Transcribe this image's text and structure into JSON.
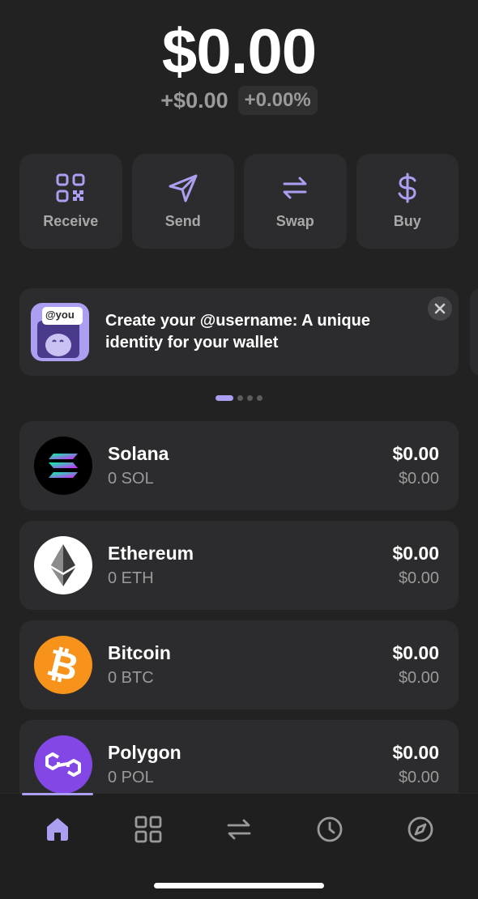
{
  "balance": {
    "total": "$0.00",
    "change_usd": "+$0.00",
    "change_pct": "+0.00%"
  },
  "actions": [
    {
      "label": "Receive",
      "icon": "qr-code-icon"
    },
    {
      "label": "Send",
      "icon": "send-icon"
    },
    {
      "label": "Swap",
      "icon": "swap-icon"
    },
    {
      "label": "Buy",
      "icon": "dollar-icon"
    }
  ],
  "banner": {
    "badge": "@you",
    "text": "Create your @username: A unique identity for your wallet"
  },
  "carousel": {
    "pages": 4,
    "active": 0
  },
  "tokens": [
    {
      "name": "Solana",
      "amount": "0 SOL",
      "value": "$0.00",
      "change": "$0.00"
    },
    {
      "name": "Ethereum",
      "amount": "0 ETH",
      "value": "$0.00",
      "change": "$0.00"
    },
    {
      "name": "Bitcoin",
      "amount": "0 BTC",
      "value": "$0.00",
      "change": "$0.00"
    },
    {
      "name": "Polygon",
      "amount": "0 POL",
      "value": "$0.00",
      "change": "$0.00"
    }
  ],
  "nav": [
    "home-icon",
    "grid-icon",
    "swap-icon",
    "clock-icon",
    "compass-icon"
  ],
  "colors": {
    "accent": "#ab9ff2",
    "background": "#222222",
    "card": "#2c2c2e",
    "muted_text": "#9a9a9a",
    "bitcoin": "#f7931a",
    "polygon": "#8247e5"
  }
}
